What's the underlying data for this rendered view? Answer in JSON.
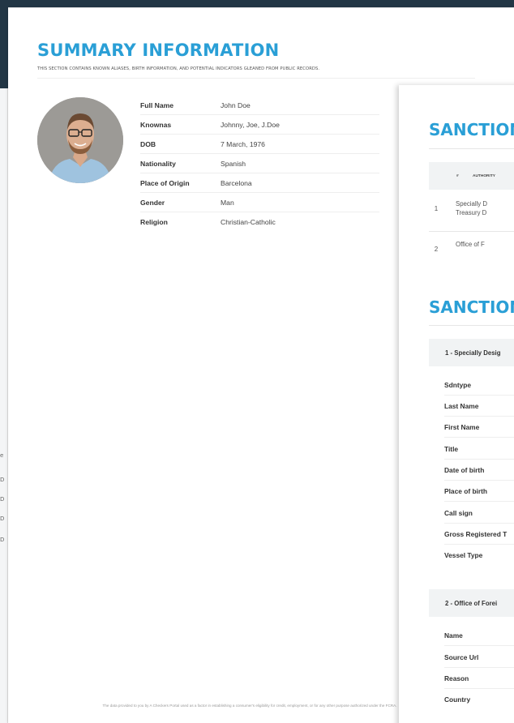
{
  "summary": {
    "title": "SUMMARY INFORMATION",
    "subtitle": "THIS SECTION CONTAINS KNOWN ALIASES, BIRTH INFORMATION, AND POTENTIAL INDICATORS GLEANED FROM PUBLIC RECORDS.",
    "fields": [
      {
        "label": "Full Name",
        "value": "John Doe"
      },
      {
        "label": "Knownas",
        "value": "Johnny, Joe, J.Doe"
      },
      {
        "label": "DOB",
        "value": "7 March, 1976"
      },
      {
        "label": "Nationality",
        "value": "Spanish"
      },
      {
        "label": "Place of Origin",
        "value": "Barcelona"
      },
      {
        "label": "Gender",
        "value": "Man"
      },
      {
        "label": "Religion",
        "value": "Christian-Catholic"
      }
    ],
    "footer": "The data provided to you by A Checkers Portal used as a factor in establishing a consumer's eligibility for credit, employment, or for any other purpose authorized under the FCRA."
  },
  "sanctions_page": {
    "heading1": "SANCTION",
    "heading2": "SANCTION",
    "table_headers": [
      "#",
      "AUTHORITY"
    ],
    "rows": [
      {
        "index": "1",
        "authority_line1": "Specially D",
        "authority_line2": "Treasury D"
      },
      {
        "index": "2",
        "authority_line1": "Office of F",
        "authority_line2": ""
      }
    ],
    "section1_title": "1 - Specially Desig",
    "section1_fields": [
      "Sdntype",
      "Last Name",
      "First Name",
      "Title",
      "Date of birth",
      "Place of birth",
      "Call sign",
      "Gross Registered T",
      "Vessel Type"
    ],
    "section2_title": "2 - Office of Forei",
    "section2_fields": [
      "Name",
      "Source Url",
      "Reason",
      "Country"
    ]
  },
  "left_strip": {
    "stubs": [
      "e",
      "D",
      "D",
      "D",
      "D"
    ]
  },
  "colors": {
    "accent": "#2a9fd6",
    "header_dark": "#223645"
  }
}
